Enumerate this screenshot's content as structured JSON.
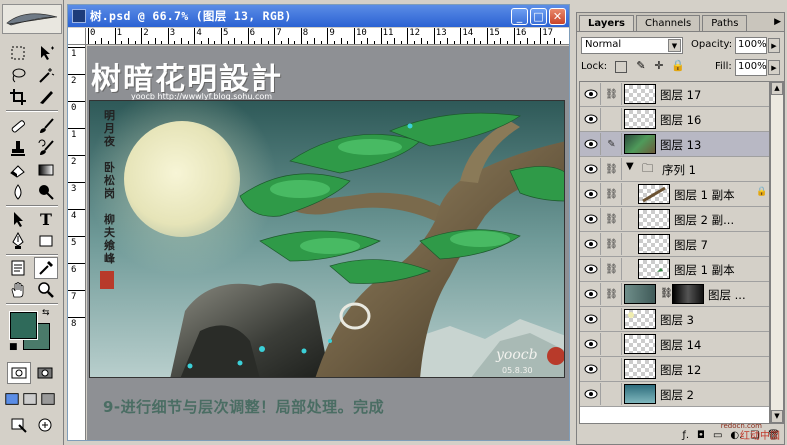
{
  "tools": {
    "items": [
      "marquee",
      "move",
      "lasso",
      "magic-wand",
      "crop",
      "slice",
      "healing-brush",
      "brush",
      "clone-stamp",
      "history-brush",
      "eraser",
      "gradient",
      "blur",
      "dodge",
      "path-selection",
      "type",
      "pen",
      "shape",
      "notes",
      "eyedropper",
      "hand",
      "zoom"
    ],
    "foreground_color": "#2f6a5a",
    "background_color": "#4a7a6a"
  },
  "document": {
    "title": "树.psd @ 66.7% (图层 13, RGB)",
    "buttons": {
      "minimize": "_",
      "maximize": "□",
      "close": "✕"
    },
    "ruler_h": [
      "0",
      "1",
      "2",
      "3",
      "4",
      "5",
      "6",
      "7",
      "8",
      "9",
      "10",
      "11",
      "12",
      "13",
      "14",
      "15",
      "16",
      "17"
    ],
    "ruler_v": [
      "1",
      "2",
      "0",
      "1",
      "2",
      "3",
      "4",
      "5",
      "6",
      "7",
      "8"
    ],
    "watermark_title": "树暗花明設計",
    "watermark_sub": "yoocb http://wwwlyf.blog.sohu.com",
    "poem": [
      "明月夜",
      "　",
      "卧松岗",
      "　",
      "柳夫飨峰"
    ],
    "signature": "yoocb",
    "signature_date": "05.8.30",
    "caption": "9-进行细节与层次调整！局部处理。完成"
  },
  "layers_panel": {
    "tabs": [
      "Layers",
      "Channels",
      "Paths"
    ],
    "blend_mode": "Normal",
    "opacity_label": "Opacity:",
    "opacity_value": "100%",
    "lock_label": "Lock:",
    "fill_label": "Fill:",
    "fill_value": "100%",
    "layers": [
      {
        "name": "图层 17",
        "indent": 0,
        "selected": false,
        "thumb": "transparent"
      },
      {
        "name": "图层 16",
        "indent": 0,
        "selected": false,
        "thumb": "transparent"
      },
      {
        "name": "图层 13",
        "indent": 0,
        "selected": true,
        "thumb": "tree"
      },
      {
        "name": "序列 1",
        "indent": 0,
        "selected": false,
        "thumb": "folder"
      },
      {
        "name": "图层 1 副本",
        "indent": 1,
        "selected": false,
        "thumb": "branch"
      },
      {
        "name": "图层 2 副...",
        "indent": 1,
        "selected": false,
        "thumb": "transparent"
      },
      {
        "name": "图层 7",
        "indent": 1,
        "selected": false,
        "thumb": "transparent"
      },
      {
        "name": "图层 1 副本",
        "indent": 1,
        "selected": false,
        "thumb": "leaf"
      },
      {
        "name": "图层 ...",
        "indent": 0,
        "selected": false,
        "thumb": "mask"
      },
      {
        "name": "图层 3",
        "indent": 0,
        "selected": false,
        "thumb": "moon"
      },
      {
        "name": "图层 14",
        "indent": 0,
        "selected": false,
        "thumb": "transparent"
      },
      {
        "name": "图层 12",
        "indent": 0,
        "selected": false,
        "thumb": "transparent"
      },
      {
        "name": "图层 2",
        "indent": 0,
        "selected": false,
        "thumb": "sky"
      }
    ],
    "site_url": "redocn.com",
    "site_credit": "红动中国"
  }
}
